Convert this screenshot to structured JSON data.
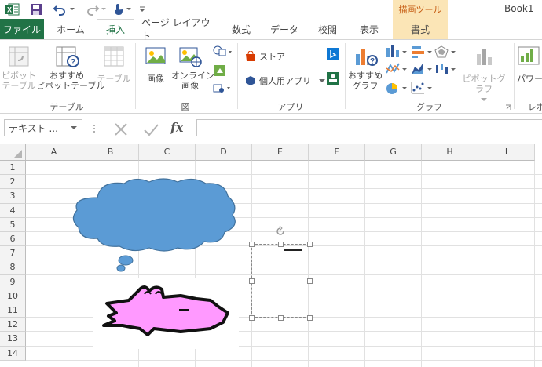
{
  "title_bar": {
    "book_title": "Book1 -",
    "drawing_tools_label": "描画ツール"
  },
  "tabs": [
    {
      "label": "ファイル"
    },
    {
      "label": "ホーム"
    },
    {
      "label": "挿入"
    },
    {
      "label": "ページ レイアウト"
    },
    {
      "label": "数式"
    },
    {
      "label": "データ"
    },
    {
      "label": "校閲"
    },
    {
      "label": "表示"
    },
    {
      "label": "書式"
    }
  ],
  "ribbon": {
    "pivot_table": "ピボット\nテーブル",
    "recommended_pivot": "おすすめ\nピボットテーブル",
    "table": "テーブル",
    "group_table": "テーブル",
    "picture": "画像",
    "online_picture": "オンライン\n画像",
    "group_illustrations": "図",
    "store": "ストア",
    "my_apps": "個人用アプリ",
    "group_apps": "アプリ",
    "recommended_charts": "おすすめ\nグラフ",
    "pivot_chart": "ピボットグラフ",
    "power_view": "パワー",
    "group_charts": "グラフ",
    "group_report": "レポ"
  },
  "formula_bar": {
    "name_box": "テキスト ...",
    "fx": "fx",
    "formula_value": ""
  },
  "columns": [
    "A",
    "B",
    "C",
    "D",
    "E",
    "F",
    "G",
    "H",
    "I"
  ],
  "rows": [
    "1",
    "2",
    "3",
    "4",
    "5",
    "6",
    "7",
    "8",
    "9",
    "10",
    "11",
    "12",
    "13",
    "14"
  ],
  "colors": {
    "excel_green": "#217346",
    "cloud_fill": "#5b9bd5",
    "cloud_stroke": "#41719c",
    "croc_fill": "#ff99ff",
    "croc_stroke": "#111111",
    "contextual_tab": "#fbe5b6"
  }
}
